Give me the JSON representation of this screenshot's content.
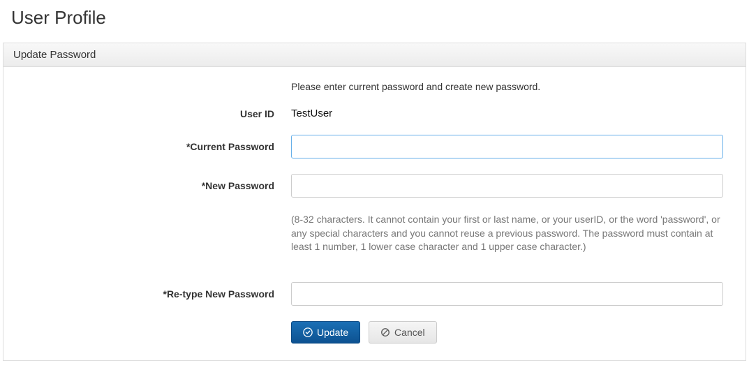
{
  "page": {
    "title": "User Profile"
  },
  "panel": {
    "header": "Update Password",
    "instruction": "Please enter current password and create new password.",
    "labels": {
      "user_id": "User ID",
      "current_password": "*Current Password",
      "new_password": "*New Password",
      "retype_password": "*Re-type New Password"
    },
    "values": {
      "user_id": "TestUser",
      "current_password": "",
      "new_password": "",
      "retype_password": ""
    },
    "help_text": "(8-32 characters. It cannot contain your first or last name, or your userID, or the word 'password', or any special characters and you cannot reuse a previous password. The password must contain at least 1 number, 1 lower case character and 1 upper case character.)",
    "buttons": {
      "update": "Update",
      "cancel": "Cancel"
    }
  }
}
